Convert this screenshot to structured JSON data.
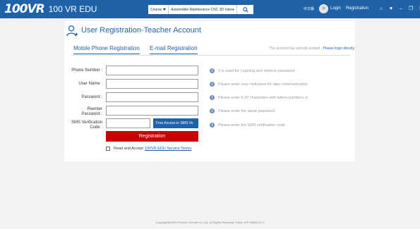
{
  "header": {
    "logo_mark": "100VR",
    "logo_text": "100 VR EDU",
    "search": {
      "category": "Course",
      "value": "Automobile Maintenance CNC 3D Interactive"
    },
    "language": "中文版",
    "login": "Login",
    "register": "Registration",
    "icons": [
      "home-icon",
      "heart-icon",
      "minimize-icon",
      "maximize-icon",
      "close-icon"
    ],
    "window_glyphs": [
      "⌂",
      "♥",
      "–",
      "❐",
      "✕"
    ]
  },
  "card": {
    "title": "User Registration-Teacher Account",
    "tabs": [
      "Mobile Phone Registration",
      "E-mail Registration"
    ],
    "existing_notice": "The account has already existed ,",
    "login_link": "Please login directly.",
    "fields": [
      {
        "label": "Phone Number :",
        "hint": "It is used for Logining and retrieve password."
      },
      {
        "label": "User Name :",
        "hint": "Please enter your nickname for later communication"
      },
      {
        "label": "Password :",
        "hint": "Please enter 6-20 characters with letters,numbers or"
      },
      {
        "label_line1": "Reenter",
        "label_line2": "Password :",
        "hint": "Please enter the same password."
      },
      {
        "label_line1": "SMS Verification",
        "label_line2": "Code :",
        "hint": "Please enter the SMS verification code"
      }
    ],
    "sms_button": "Free Access to SMS Ve",
    "register_button": "Registration",
    "agree_text": "Read and Accept",
    "agree_link": "100VR EDU Service Terms"
  },
  "footer": "Copyright@2020 Phoenix Oresoft Co.,Ltd.   All Rights Reserved. Fujian ICP 09005447-1",
  "colors": {
    "header": "#1f62a8",
    "accent": "#1f62a8",
    "register_button": "#c80000",
    "background": "#f2f2f2"
  }
}
